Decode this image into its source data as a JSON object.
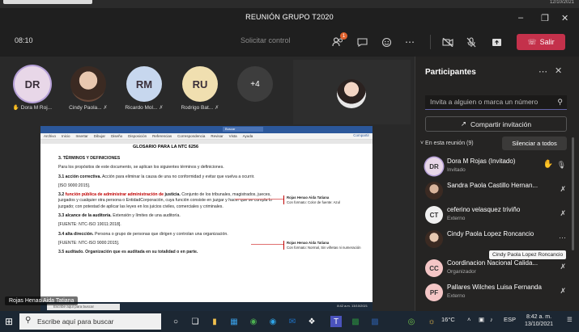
{
  "window": {
    "title": "REUNIÓN GRUPO T2020",
    "top_clock": "12/10/2021",
    "minimize_icon": "minimize-icon",
    "maximize_icon": "maximize-icon",
    "close_icon": "close-icon"
  },
  "toolbar": {
    "timer": "08:10",
    "request_control": "Solicitar control",
    "participants_badge": "1",
    "leave_label": "Salir"
  },
  "tiles": [
    {
      "initials": "DR",
      "name": "Dora M Roj...",
      "color": "#e8d7e8",
      "hand": true
    },
    {
      "initials": "",
      "name": "Cindy Paola...",
      "color": "#e8c8b0",
      "photo": true
    },
    {
      "initials": "RM",
      "name": "Ricardo Mol...",
      "color": "#c7d7ee"
    },
    {
      "initials": "RU",
      "name": "Rodrigo Bat...",
      "color": "#f0dfb0"
    }
  ],
  "overflow_label": "+4",
  "presenter_label": "Rojas Henao Aida Tatiana",
  "shared": {
    "word_title": "Buscar",
    "menu": [
      "Archivo",
      "Inicio",
      "Insertar",
      "Dibujar",
      "Diseño",
      "Disposición",
      "Referencias",
      "Correspondencia",
      "Revisar",
      "Vista",
      "Ayuda"
    ],
    "share_btn": "Compartir",
    "doc_title": "GLOSARIO PARA LA NTC 6256",
    "heading": "3. TÉRMINOS Y DEFINICIONES",
    "intro": "Para los propósitos de este documento, se aplican los siguientes términos y definiciones.",
    "t31_label": "3.1 acción correctiva.",
    "t31_text": "Acción para eliminar la causa de una no conformidad y evitar que vuelva a ocurrir.",
    "t31_src": "[ISO 9000:2015].",
    "t32_label": "3.2",
    "t32_red": "función pública de administrar administración de",
    "t32_bold": "justicia.",
    "t32_text": "Conjunto de los tribunales, magistrados, jueces, juzgados y cualquier otra persona o EntidadCorporación, cuya función consiste en juzgar y hacer que se cumpla lo juzgado; con potestad de aplicar las leyes en los juicios civiles, comerciales y criminales.",
    "t33_label": "3.3 alcance de la auditoría.",
    "t33_text": "Extensión y límites de una auditoría.",
    "t33_src": "[FUENTE: NTC-ISO 19011:2018].",
    "t34_label": "3.4 alta dirección.",
    "t34_text": "Persona o grupo de personas que dirigen y controlan una organización.",
    "t34_src": "[FUENTE: NTC-ISO 9000:2015].",
    "t35": "3.5 auditado. Organización que es auditada en su totalidad o en parte.",
    "comment1_author": "Rojas Henao Aida Tatiana",
    "comment1_text": "Con formato: Color de fuente: Azul",
    "comment2_author": "Rojas Henao Aida Tatiana",
    "comment2_text": "Con formato: Normal, Sin viñetas ni numeración",
    "remote_search": "Escribe aquí para buscar",
    "remote_clock": "8:42 a.m. 13/10/2021"
  },
  "panel": {
    "title": "Participantes",
    "invite_placeholder": "Invita a alguien o marca un número",
    "share_invite": "Compartir invitación",
    "in_meeting": "En esta reunión (9)",
    "mute_all": "Silenciar a todos",
    "participants": [
      {
        "initials": "DR",
        "name": "Dora M Rojas (Invitado)",
        "role": "Invitado",
        "color": "#e8d7e8",
        "hand": true,
        "mic": "on"
      },
      {
        "initials": "",
        "name": "Sandra Paola Castillo Hernan...",
        "role": "",
        "color": "#c9a58a",
        "mic": "muted"
      },
      {
        "initials": "CT",
        "name": "ceferino velasquez triviño",
        "role": "Externo",
        "color": "#f0f0f0",
        "mic": "muted"
      },
      {
        "initials": "",
        "name": "Cindy Paola Lopez Roncancio",
        "role": "",
        "color": "#e8c8b0",
        "mic": "more"
      },
      {
        "initials": "CC",
        "name": "Coordinacion Nacional Calida...",
        "role": "Organizador",
        "color": "#f4c6c6",
        "mic": "muted"
      },
      {
        "initials": "PF",
        "name": "Pallares Wilches Luisa Fernanda",
        "role": "Externo",
        "color": "#f4c6c6",
        "mic": "muted"
      }
    ],
    "tooltip": "Cindy Paola Lopez Roncancio"
  },
  "taskbar": {
    "search_placeholder": "Escribe aquí para buscar",
    "weather": "16°C",
    "lang": "ESP",
    "time": "8:42 a. m.",
    "date": "13/10/2021"
  }
}
